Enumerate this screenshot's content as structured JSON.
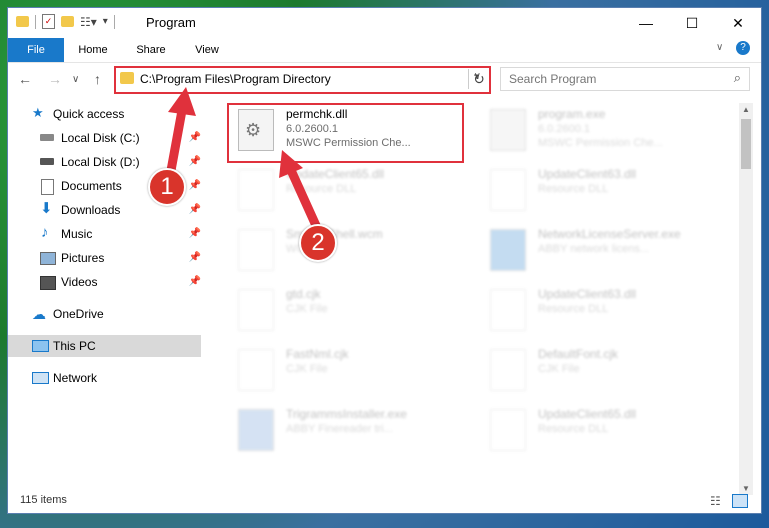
{
  "window": {
    "title": "Program"
  },
  "ribbon": {
    "tabs": [
      "File",
      "Home",
      "Share",
      "View"
    ]
  },
  "address": {
    "path": "C:\\Program Files\\Program Directory"
  },
  "search": {
    "placeholder": "Search Program"
  },
  "nav": {
    "quick_access": "Quick access",
    "items": [
      {
        "label": "Local Disk (C:)",
        "icon": "drive-icon"
      },
      {
        "label": "Local Disk (D:)",
        "icon": "drive-icon"
      },
      {
        "label": "Documents",
        "icon": "documents-icon"
      },
      {
        "label": "Downloads",
        "icon": "download-icon"
      },
      {
        "label": "Music",
        "icon": "music-icon"
      },
      {
        "label": "Pictures",
        "icon": "pictures-icon"
      },
      {
        "label": "Videos",
        "icon": "videos-icon"
      }
    ],
    "onedrive": "OneDrive",
    "this_pc": "This PC",
    "network": "Network"
  },
  "files": {
    "highlighted": {
      "name": "permchk.dll",
      "version": "6.0.2600.1",
      "desc": "MSWC Permission Che..."
    },
    "right_column": [
      {
        "name": "program.exe",
        "version": "6.0.2600.1",
        "desc": "MSWC Permission Che..."
      },
      {
        "name": "UpdateClient63.dll",
        "desc": "Resource DLL"
      },
      {
        "name": "NetworkLicenseServer.exe",
        "desc": "ABBY network licens..."
      },
      {
        "name": "UpdateClient63.dll",
        "desc": "Resource DLL"
      },
      {
        "name": "DefaultFont.cjk",
        "desc": "CJK File"
      },
      {
        "name": "UpdateClient65.dll",
        "desc": "Resource DLL"
      }
    ],
    "left_column": [
      {
        "name": "UpdateClient65.dll",
        "desc": "Resource DLL"
      },
      {
        "name": "SmlResShell.wcm",
        "desc": "WCM File"
      },
      {
        "name": "gtd.cjk",
        "desc": "CJK File"
      },
      {
        "name": "FastNml.cjk",
        "desc": "CJK File"
      },
      {
        "name": "TrigrammsInstaller.exe",
        "desc": "ABBY Finereader tri..."
      }
    ]
  },
  "status": {
    "count": "115 items"
  },
  "annotations": [
    "1",
    "2"
  ],
  "colors": {
    "accent": "#1979ca",
    "highlight": "#e0313c"
  }
}
